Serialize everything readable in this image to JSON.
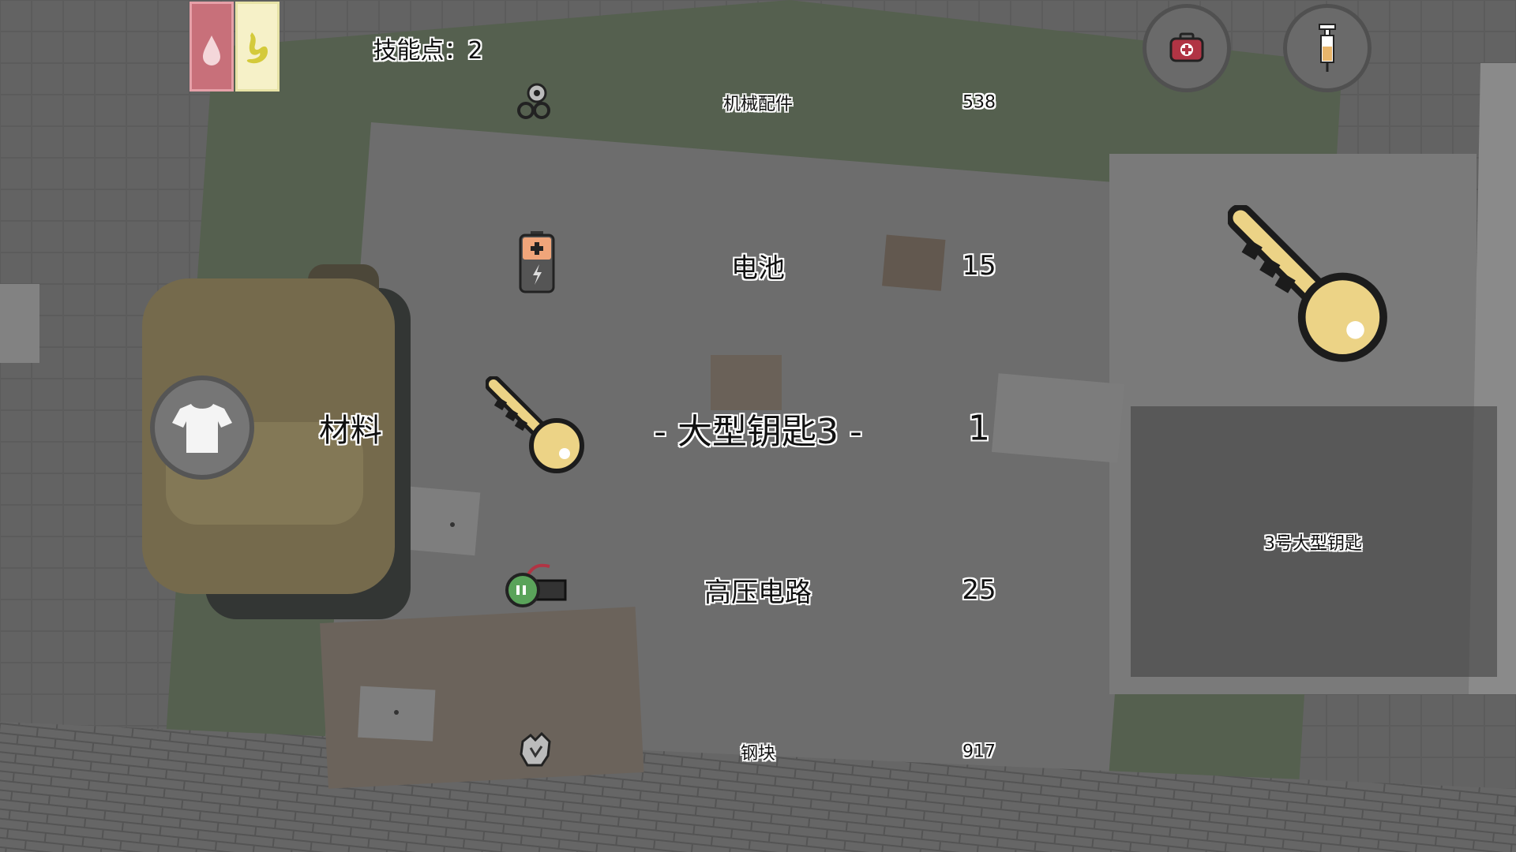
{
  "hud": {
    "skill_points": "技能点：2",
    "stats": [
      {
        "name": "thirst",
        "icon": "water-drop-icon",
        "color": "#c8707a"
      },
      {
        "name": "hunger",
        "icon": "stomach-icon",
        "color": "#f6f1c8"
      }
    ],
    "quick_buttons": [
      {
        "icon": "first-aid-kit-icon"
      },
      {
        "icon": "syringe-icon"
      }
    ]
  },
  "inventory": {
    "backpack_icon": "backpack-icon",
    "category_button_icon": "tshirt-icon",
    "category_label": "材料",
    "items": [
      {
        "icon": "machine-parts-icon",
        "name": "机械配件",
        "count": "538"
      },
      {
        "icon": "battery-icon",
        "name": "电池",
        "count": "15"
      },
      {
        "icon": "large-key-icon",
        "name": "- 大型钥匙3 -",
        "count": "1"
      },
      {
        "icon": "high-voltage-circuit-icon",
        "name": "高压电路",
        "count": "25"
      },
      {
        "icon": "steel-block-icon",
        "name": "钢块",
        "count": "917"
      }
    ],
    "selected_index": 2
  },
  "detail": {
    "icon": "large-key-icon",
    "description": "3号大型钥匙"
  },
  "colors": {
    "key": "#ecd386",
    "key_outline": "#1c1c1c",
    "thirst_bar": "#c8707a",
    "hunger_bar": "#f6f1c8",
    "grass": "#55604f",
    "floor": "#6b6b6b"
  }
}
